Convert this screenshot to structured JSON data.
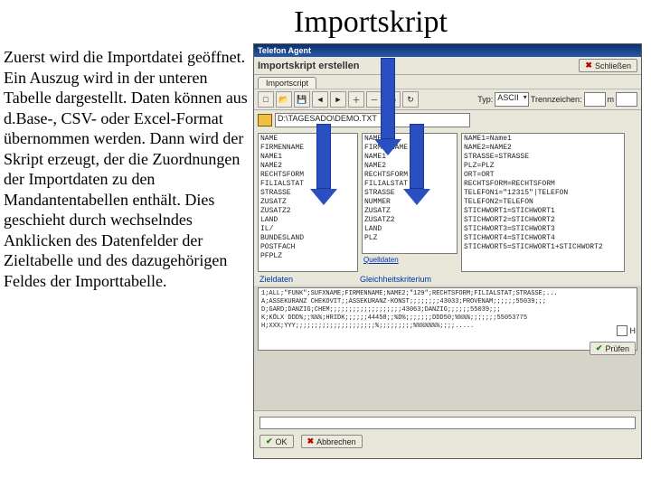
{
  "slide": {
    "title": "Importskript",
    "body": "Zuerst wird die Importdatei geöffnet. Ein Auszug wird in der unteren Tabelle dargestellt. Daten können aus d.Base-, CSV- oder Excel-Format übernommen werden.  Dann wird der Skript erzeugt, der die Zuordnungen der Importdaten zu den Mandantentabellen enthält. Dies geschieht durch wechselndes Anklicken des Datenfelder der Zieltabelle und des dazugehörigen Feldes der Importtabelle."
  },
  "dialog": {
    "window_title": "Telefon Agent",
    "header_title": "Importskript erstellen",
    "close_btn": "Schließen",
    "tab": "Importscript",
    "typ_label": "Typ:",
    "typ_value": "ASCII",
    "trenn_label": "Trennzeichen:",
    "trenn_value": "",
    "m_label": "m",
    "m_value": "",
    "file_path": "D:\\TAGESADO\\DEMO.TXT",
    "left_fields": [
      "NAME",
      "FIRMENNAME",
      "NAME1",
      "NAME2",
      "RECHTSFORM",
      "FILIALSTAT",
      "STRASSE",
      "ZUSATZ",
      "ZUSATZ2",
      "LAND",
      "IL/",
      "BUNDESLAND",
      "POSTFACH",
      "PFPLZ"
    ],
    "mid_fields": [
      "NAME",
      "FIRMENNAME",
      "NAME1",
      "NAME2",
      "RECHTSFORM",
      "FILIALSTAT",
      "STRASSE",
      "NUMMER",
      "ZUSATZ",
      "ZUSATZ2",
      "LAND",
      "PLZ"
    ],
    "mid_link": "Quelldaten",
    "right_fields": [
      "NAME1=Name1",
      "NAME2=NAME2",
      "STRASSE=STRASSE",
      "PLZ=PLZ",
      "ORT=ORT",
      "RECHTSFORM=RECHTSFORM",
      "TELEFON1=\"12315\"|TELEFON",
      "TELEFON2=TELEFON",
      "STICHWORT1=STICHWORT1",
      "STICHWORT2=STICHWORT2",
      "STICHWORT3=STICHWORT3",
      "STICHWORT4=STICHWORT4",
      "STICHWORT5=STICHWORT1+STICHWORT2"
    ],
    "target_label": "Zieldaten",
    "match_label": "Gleichheitskriterium",
    "script_lines": [
      "1;ALL;\"FUNK\";SUFXNAME;FIRMENNAME;NAME2;\"129\";RECHTSFORM;FILIALSTAT;STRASSE;...",
      "A;ASSEKURANZ CHEKOVIT;;ASSEKURANZ-KONST;;;;;;;;43033;PROVENAM;;;;;;55039;;;",
      "D;GARD;DANZIG;CHEM;;;;;;;;;;;;;;;;;;;43063;DANZIG;;;;;;55039;;;",
      "K;KÖLX DDD%;;%%%;HRIDK;;;;;;44458;;%D%;;;;;;;DDD50;%%%%;;;;;;;55053775",
      "H;XXX;YYY;;;;;;;;;;;;;;;;;;;;;%;;;;;;;;;%%%%%%%;;;;....."
    ],
    "checkbox_h": "H",
    "pruefen_btn": "Prüfen",
    "ok_btn": "OK",
    "cancel_btn": "Abbrechen",
    "toolbar_icons": [
      "new",
      "open",
      "save",
      "arrow-left",
      "arrow-right",
      "plus",
      "minus",
      "target",
      "refresh"
    ]
  }
}
